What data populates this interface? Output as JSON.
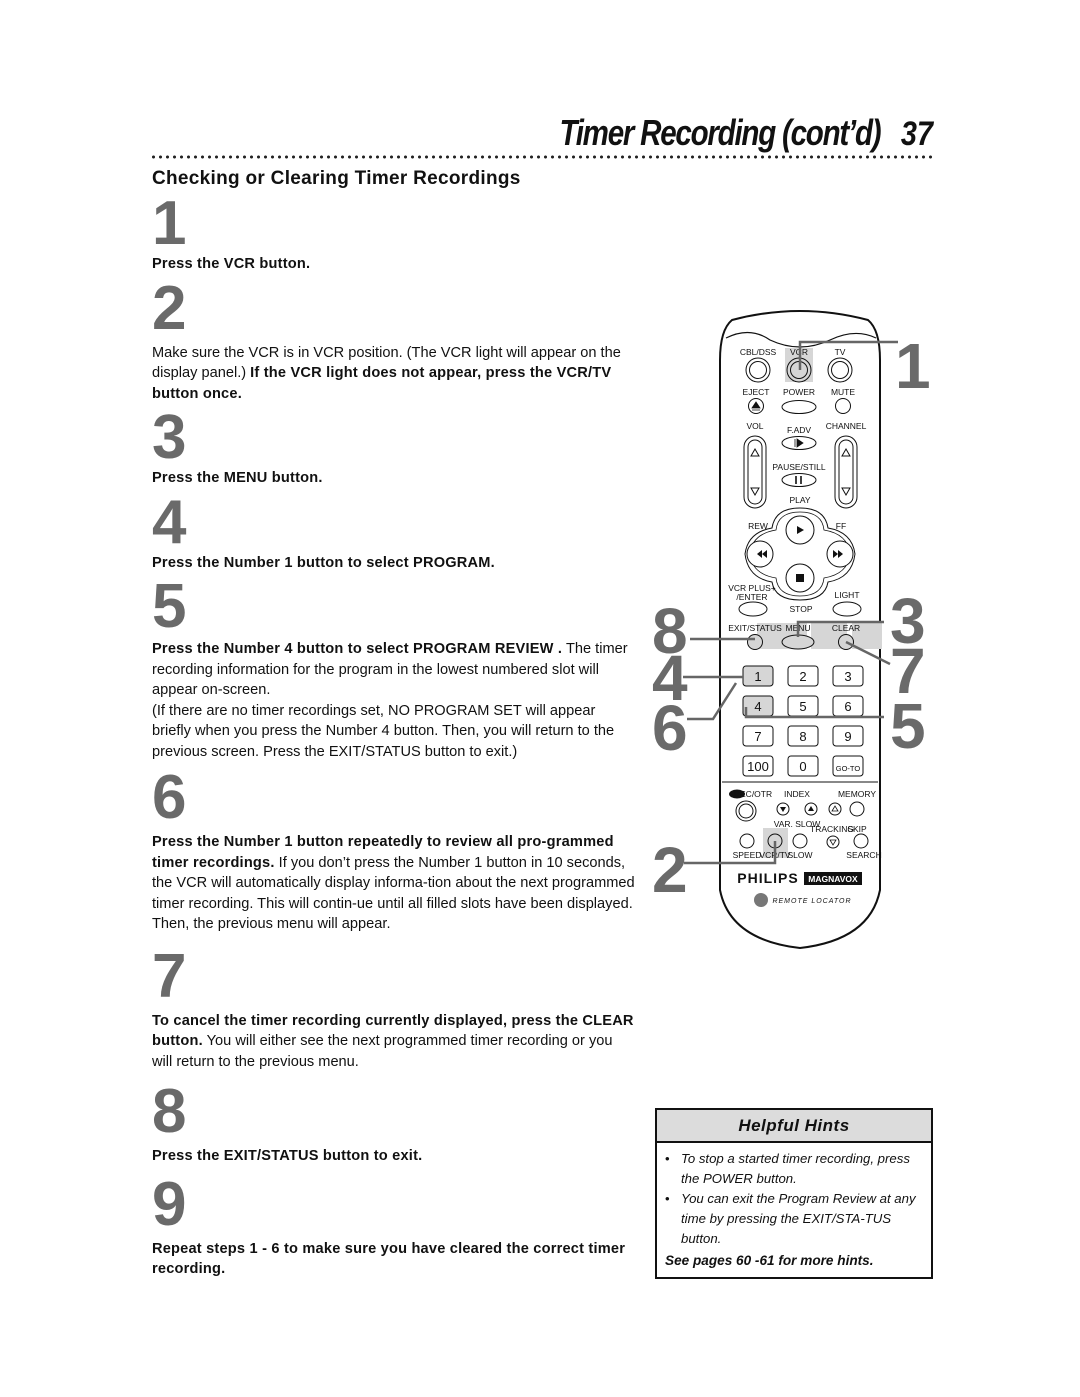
{
  "header": {
    "title": "Timer Recording (cont’d)",
    "page_number": "37"
  },
  "section_title": "Checking or Clearing Timer Recordings",
  "steps": [
    {
      "number": "1",
      "bold": "Press the VCR button.",
      "text": ""
    },
    {
      "number": "2",
      "pre": "Make sure the VCR is in VCR position. (The VCR light will appear on the display panel.) ",
      "bold": "If the VCR light does not appear, press the VCR/TV button once.",
      "text": ""
    },
    {
      "number": "3",
      "bold": "Press the MENU button.",
      "text": ""
    },
    {
      "number": "4",
      "bold": "Press the Number 1 button to select PROGRAM.",
      "text": ""
    },
    {
      "number": "5",
      "bold": "Press the Number 4 button to select PROGRAM REVIEW .",
      "text": " The timer recording information for the program in the lowest numbered slot will appear on-screen.",
      "text2": "(If there are no timer recordings set, NO PROGRAM SET will appear briefly when you press the Number 4 button. Then, you will return to the previous screen. Press the EXIT/STATUS button to exit.)"
    },
    {
      "number": "6",
      "bold": "Press the Number 1 button repeatedly to review all pro-grammed timer recordings.",
      "text": " If you don’t press the Number 1 button in 10 seconds, the VCR will automatically display informa-tion about the next programmed timer recording. This will contin-ue until all filled slots have been displayed. Then, the previous menu will appear."
    },
    {
      "number": "7",
      "bold": "To cancel the timer recording currently displayed, press the CLEAR button.",
      "text": " You will either see the next programmed timer recording or you will return to the previous menu."
    },
    {
      "number": "8",
      "bold": "Press the EXIT/STATUS button to exit.",
      "text": ""
    },
    {
      "number": "9",
      "bold": "Repeat steps 1 - 6 to make sure you have cleared the correct timer recording.",
      "text": ""
    }
  ],
  "remote": {
    "labels": {
      "cbl_dss": "CBL/DSS",
      "vcr": "VCR",
      "tv": "TV",
      "eject": "EJECT",
      "power": "POWER",
      "mute": "MUTE",
      "vol": "VOL",
      "f_adv": "F.ADV",
      "channel": "CHANNEL",
      "pause_still": "PAUSE/STILL",
      "play": "PLAY",
      "rew": "REW",
      "ff": "FF",
      "vcr_plus": "VCR PLUS+",
      "enter": "/ENTER",
      "light": "LIGHT",
      "stop": "STOP",
      "exit_status": "EXIT/STATUS",
      "menu": "MENU",
      "clear": "CLEAR",
      "rec_otr": "REC/OTR",
      "index": "INDEX",
      "memory": "MEMORY",
      "var_slow": "VAR. SLOW",
      "tracking": "TRACKING",
      "skip": "SKIP",
      "speed": "SPEED",
      "vcr_tv": "VCR/TV",
      "slow": "SLOW",
      "search": "SEARCH",
      "brand1": "PHILIPS",
      "brand2": "MAGNAVOX",
      "remote_locator": "REMOTE LOCATOR"
    },
    "keypad": [
      "1",
      "2",
      "3",
      "4",
      "5",
      "6",
      "7",
      "8",
      "9",
      "100",
      "0",
      "GO-TO"
    ],
    "callouts": {
      "c1": "1",
      "c2": "2",
      "c3": "3",
      "c4": "4",
      "c5": "5",
      "c6": "6",
      "c7": "7",
      "c8": "8"
    }
  },
  "hints": {
    "title": "Helpful Hints",
    "items": [
      "To stop a started timer recording, press the POWER button.",
      "You can exit the Program Review at any time by pressing the EXIT/STA-TUS button."
    ],
    "footer": "See pages 60 -61 for more hints."
  }
}
